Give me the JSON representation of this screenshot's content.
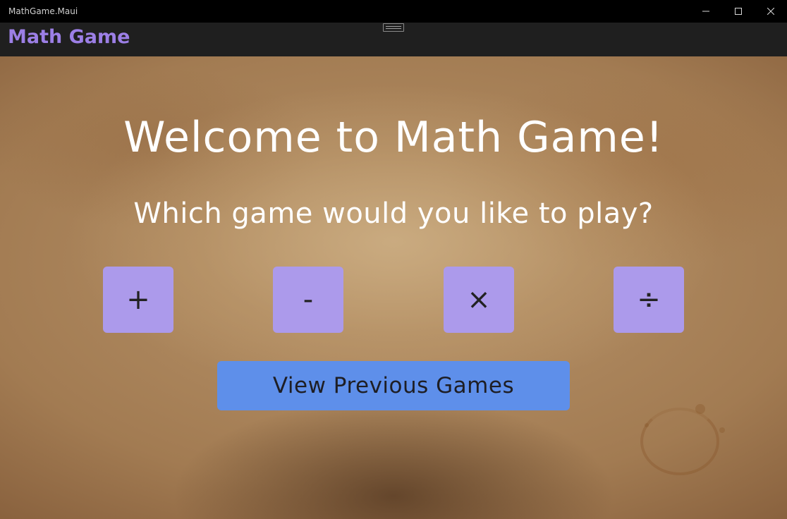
{
  "window": {
    "title": "MathGame.Maui",
    "controls": {
      "minimize_icon": "minimize-icon",
      "maximize_icon": "maximize-icon",
      "close_icon": "close-icon"
    }
  },
  "appbar": {
    "title": "Math Game",
    "title_color": "#9c7fe6"
  },
  "main": {
    "welcome": "Welcome to Math Game!",
    "question": "Which game would you like to play?",
    "operations": [
      {
        "label": "+",
        "name": "addition"
      },
      {
        "label": "-",
        "name": "subtraction"
      },
      {
        "label": "×",
        "name": "multiplication"
      },
      {
        "label": "÷",
        "name": "division"
      }
    ],
    "history_button": "View Previous Games"
  },
  "colors": {
    "operation_button": "#ac9aeb",
    "history_button": "#5e8fea"
  }
}
